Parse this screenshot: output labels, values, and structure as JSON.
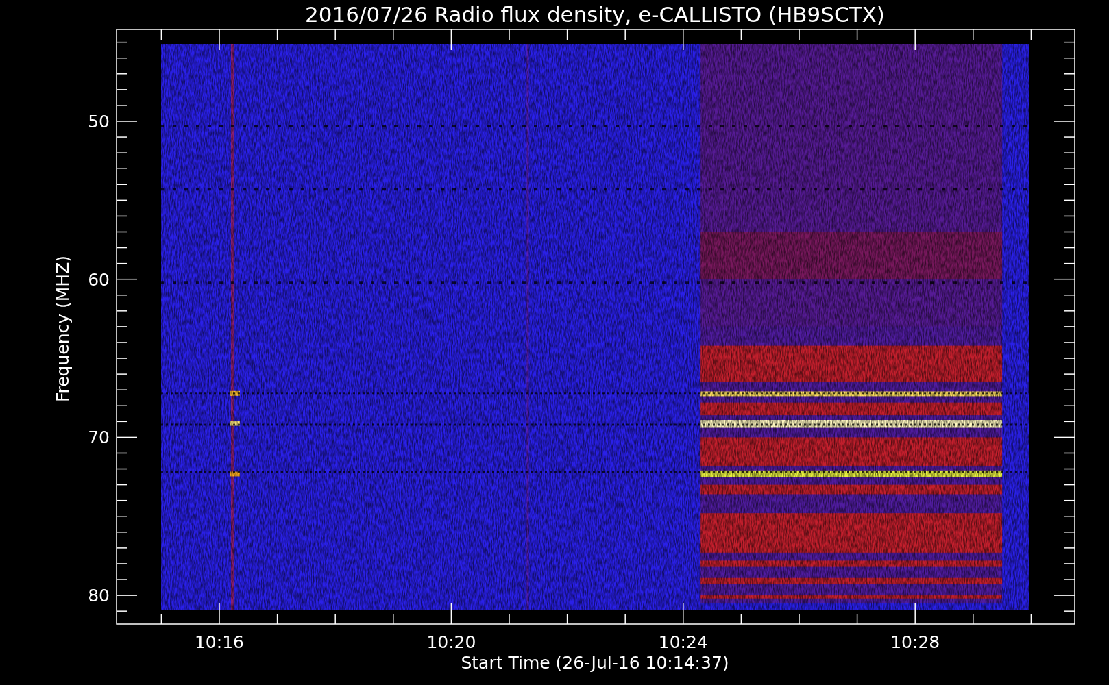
{
  "title": "2016/07/26  Radio flux density, e-CALLISTO (HB9SCTX)",
  "ylabel": "Frequency (MHZ)",
  "xlabel": "Start Time (26-Jul-16 10:14:37)",
  "yticks": [
    "50",
    "60",
    "70",
    "80"
  ],
  "xticks": [
    "10:16",
    "10:20",
    "10:24",
    "10:28"
  ]
}
